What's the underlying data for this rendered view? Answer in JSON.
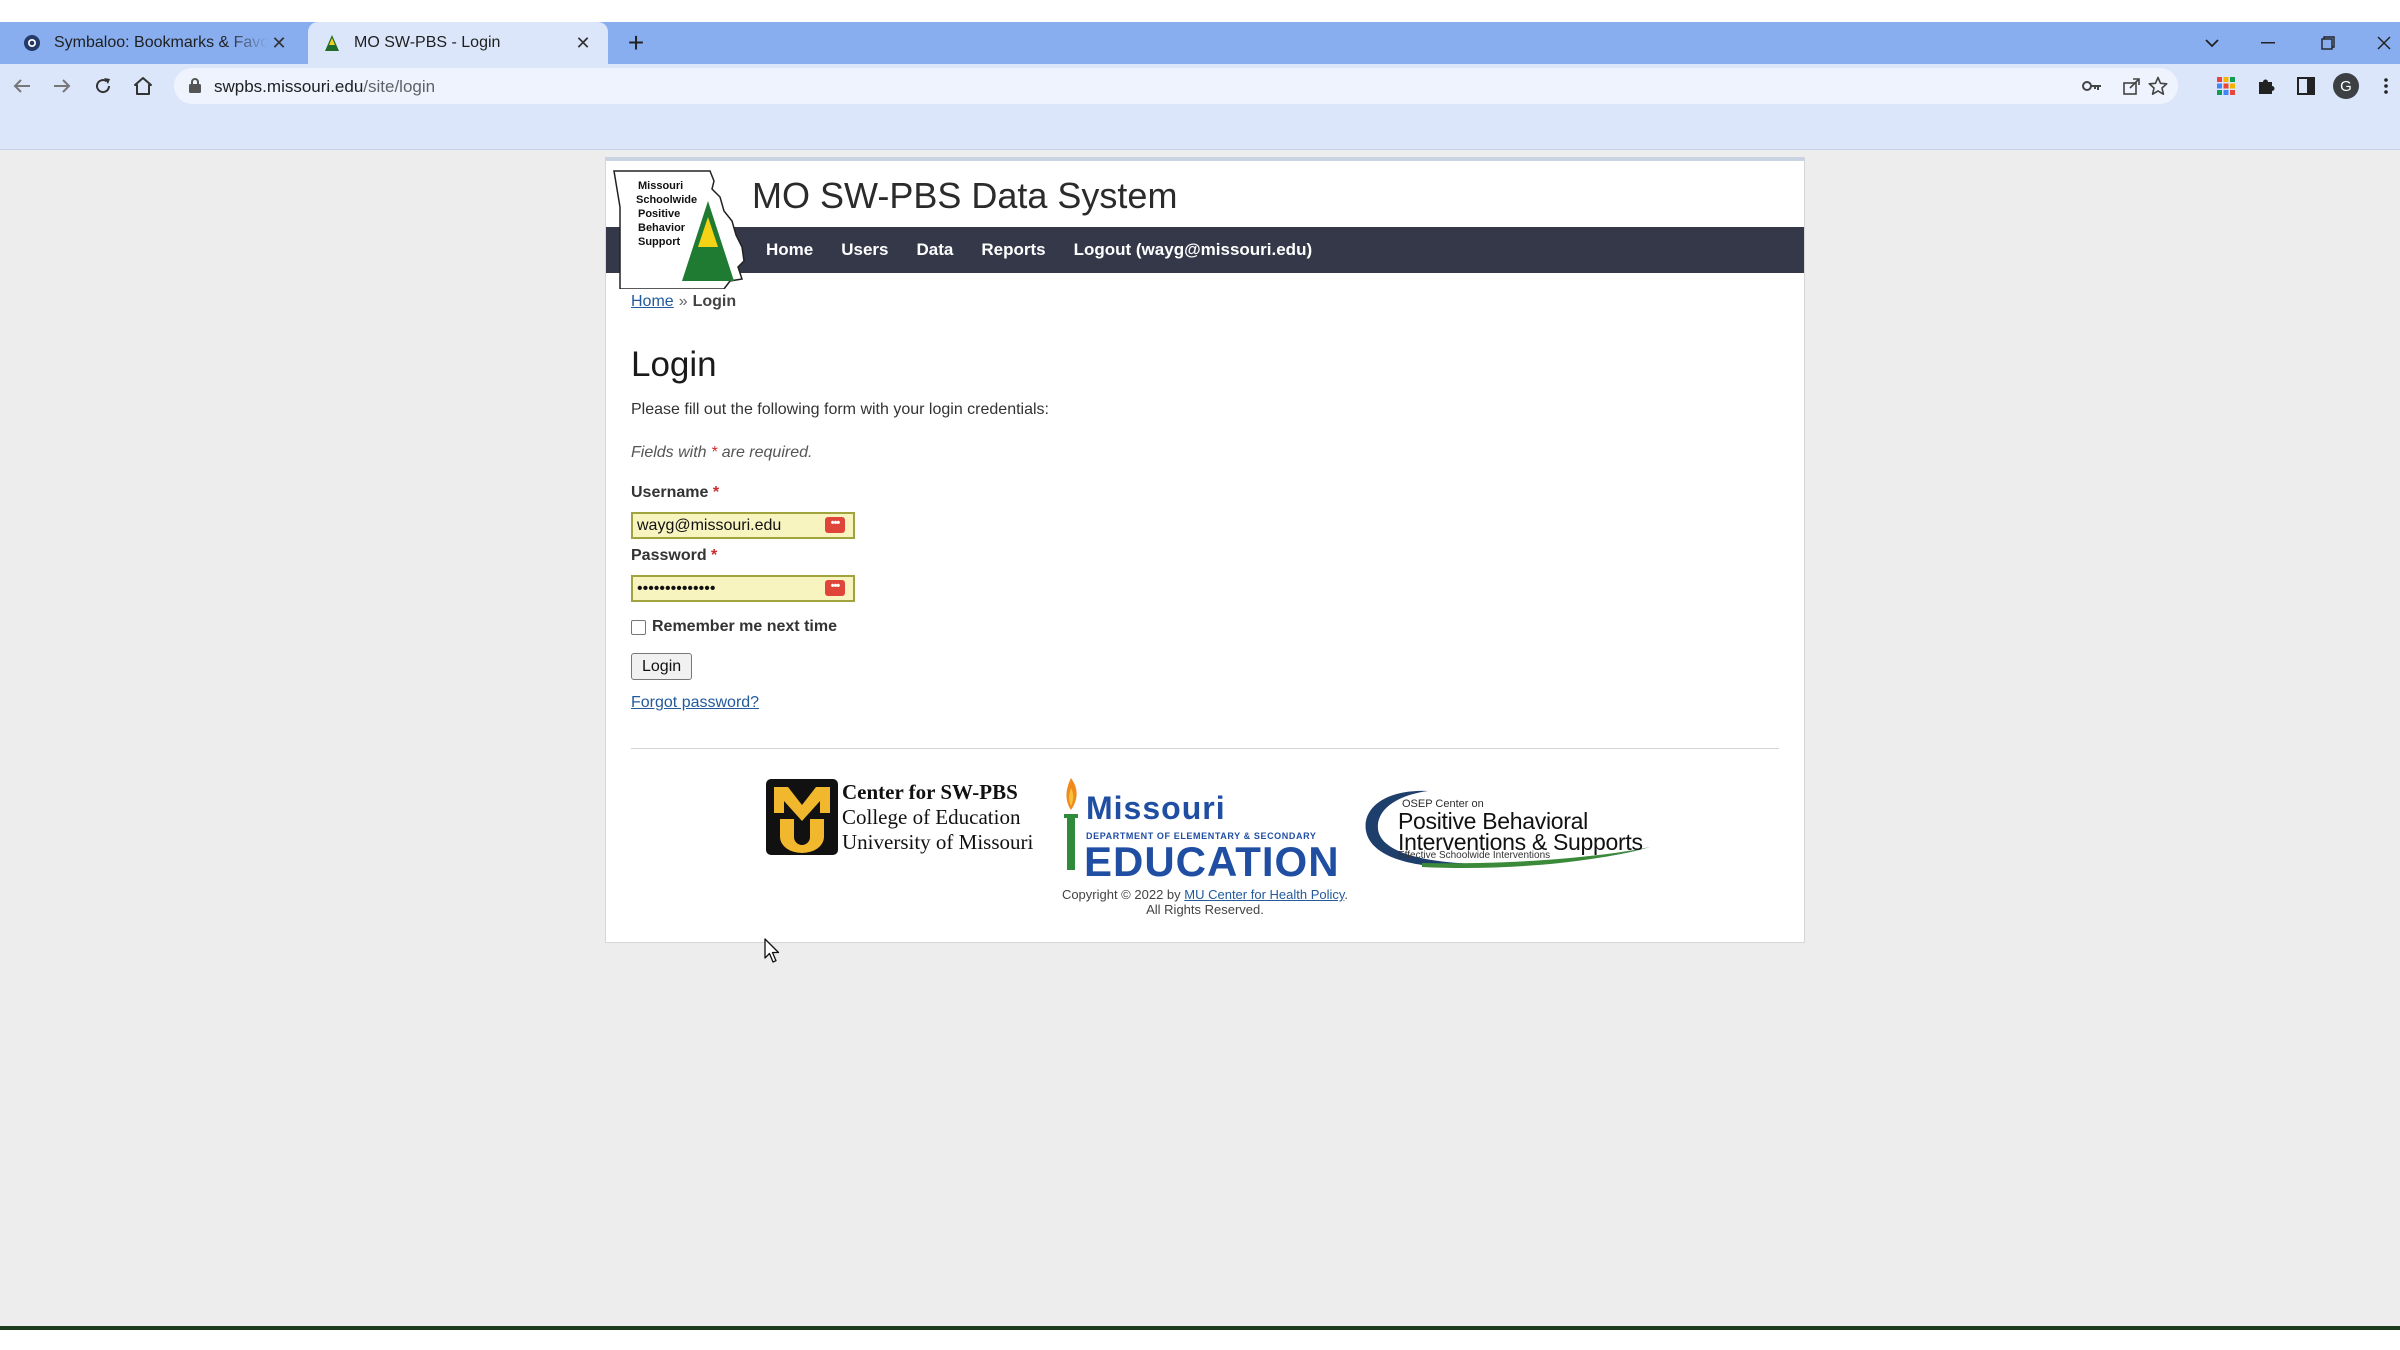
{
  "browser": {
    "tabs": [
      {
        "title": "Symbaloo: Bookmarks & Favorites",
        "active": false
      },
      {
        "title": "MO SW-PBS - Login",
        "active": true
      }
    ],
    "url_host": "swpbs.missouri.edu",
    "url_path": "/site/login",
    "profile_initial": "G"
  },
  "site": {
    "logo": {
      "line1": "Missouri",
      "line2": "Schoolwide",
      "line3": "Positive",
      "line4": "Behavior",
      "line5": "Support"
    },
    "title": "MO SW-PBS Data System",
    "nav": [
      "Home",
      "Users",
      "Data",
      "Reports",
      "Logout (wayg@missouri.edu)"
    ]
  },
  "breadcrumb": {
    "home": "Home",
    "separator": "»",
    "current": "Login"
  },
  "login": {
    "heading": "Login",
    "intro": "Please fill out the following form with your login credentials:",
    "note_before": "Fields with",
    "required_mark": "*",
    "note_after": "are required.",
    "username_label": "Username",
    "username_value": "wayg@missouri.edu",
    "password_label": "Password",
    "password_value": "••••••••••••••",
    "remember_label": "Remember me next time",
    "remember_checked": false,
    "login_button": "Login",
    "forgot_link": "Forgot password?"
  },
  "footer": {
    "mu_line1": "Center for SW-PBS",
    "mu_line2": "College of Education",
    "mu_line3": "University of Missouri",
    "dese_line1": "Missouri",
    "dese_line2": "DEPARTMENT OF ELEMENTARY & SECONDARY",
    "dese_line3": "EDUCATION",
    "pbis_line0": "OSEP Center on",
    "pbis_line1": "Positive Behavioral",
    "pbis_line2": "Interventions & Supports",
    "pbis_line3": "Effective Schoolwide Interventions",
    "copyright_prefix": "Copyright © 2022 by",
    "copyright_link": "MU Center for Health Policy",
    "copyright_suffix": ".",
    "rights": "All Rights Reserved."
  },
  "colors": {
    "tab_bar": "#88aef0",
    "toolbar": "#dbe6fb",
    "nav_bar": "#343849",
    "link": "#225a9c",
    "required": "#cc2b2b",
    "field_fill": "#f7f4c0"
  }
}
